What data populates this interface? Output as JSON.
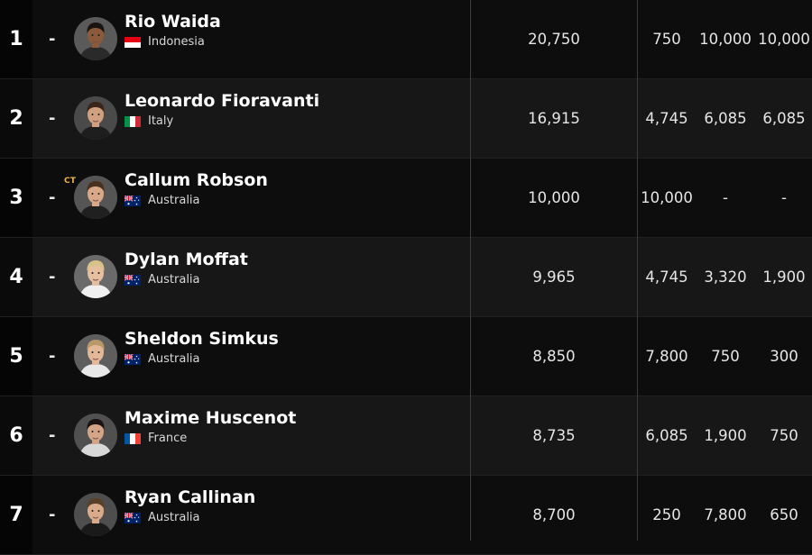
{
  "rankings": [
    {
      "rank": "1",
      "change": "-",
      "ct": "",
      "name": "Rio Waida",
      "country": "Indonesia",
      "flag": "indonesia",
      "total": "20,750",
      "h1": "750",
      "h2": "10,000",
      "h3": "10,000"
    },
    {
      "rank": "2",
      "change": "-",
      "ct": "",
      "name": "Leonardo Fioravanti",
      "country": "Italy",
      "flag": "italy",
      "total": "16,915",
      "h1": "4,745",
      "h2": "6,085",
      "h3": "6,085"
    },
    {
      "rank": "3",
      "change": "-",
      "ct": "CT",
      "name": "Callum Robson",
      "country": "Australia",
      "flag": "australia",
      "total": "10,000",
      "h1": "10,000",
      "h2": "-",
      "h3": "-"
    },
    {
      "rank": "4",
      "change": "-",
      "ct": "",
      "name": "Dylan Moffat",
      "country": "Australia",
      "flag": "australia",
      "total": "9,965",
      "h1": "4,745",
      "h2": "3,320",
      "h3": "1,900"
    },
    {
      "rank": "5",
      "change": "-",
      "ct": "",
      "name": "Sheldon Simkus",
      "country": "Australia",
      "flag": "australia",
      "total": "8,850",
      "h1": "7,800",
      "h2": "750",
      "h3": "300"
    },
    {
      "rank": "6",
      "change": "-",
      "ct": "",
      "name": "Maxime Huscenot",
      "country": "France",
      "flag": "france",
      "total": "8,735",
      "h1": "6,085",
      "h2": "1,900",
      "h3": "750"
    },
    {
      "rank": "7",
      "change": "-",
      "ct": "",
      "name": "Ryan Callinan",
      "country": "Australia",
      "flag": "australia",
      "total": "8,700",
      "h1": "250",
      "h2": "7,800",
      "h3": "650"
    }
  ],
  "colors": {
    "row_dark": "#0d0d0d",
    "row_light": "#171717",
    "rank_cell": "#050505",
    "divider": "#3c3c3c",
    "ct_badge": "#e8b64a"
  }
}
